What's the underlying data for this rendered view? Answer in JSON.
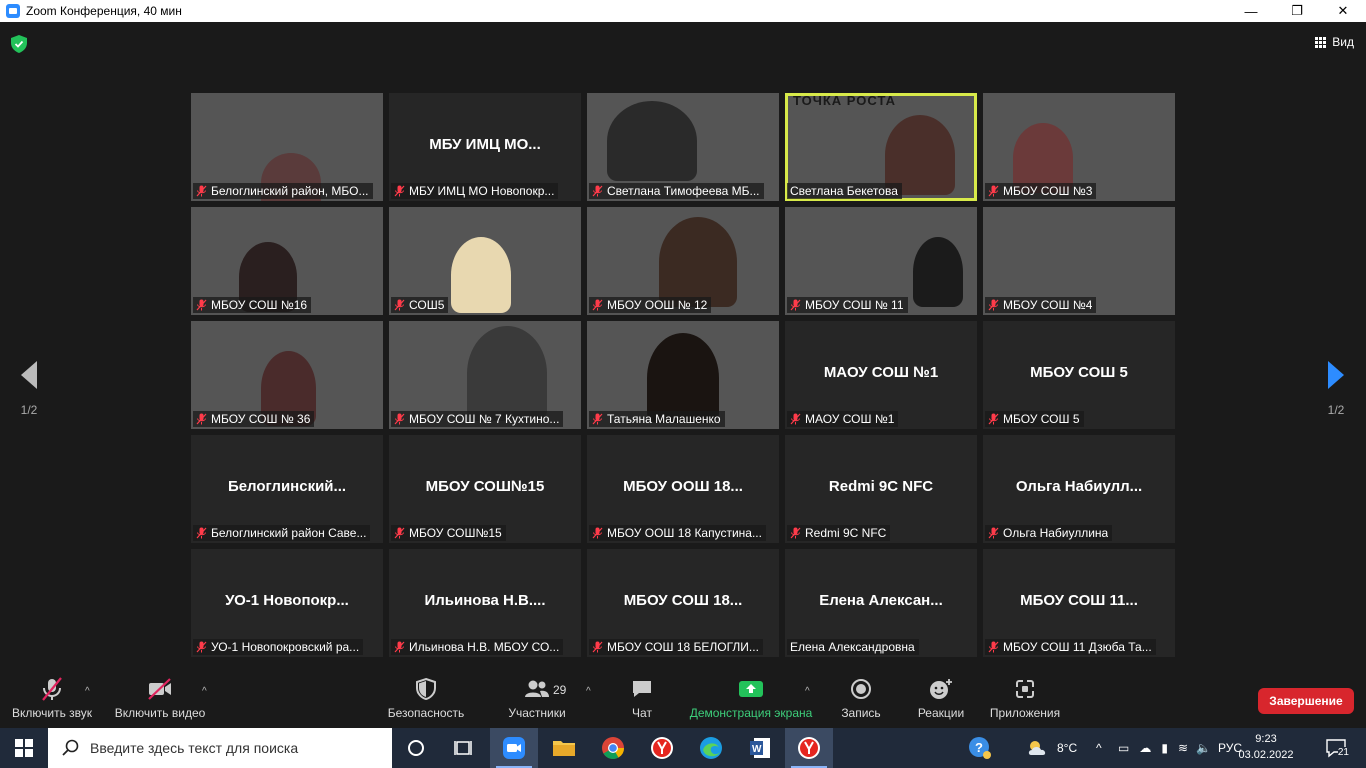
{
  "window": {
    "title": "Zoom Конференция, 40 мин",
    "controls": [
      "—",
      "❐",
      "✕"
    ]
  },
  "topbar": {
    "view_label": "Вид"
  },
  "pager": {
    "left": "1/2",
    "right": "1/2"
  },
  "tiles": [
    {
      "label": "Белоглинский район, МБО...",
      "center": "",
      "muted": true
    },
    {
      "label": "МБУ ИМЦ МО Новопокр...",
      "center": "МБУ ИМЦ МО...",
      "muted": true
    },
    {
      "label": "Светлана Тимофеева МБ...",
      "center": "",
      "muted": true
    },
    {
      "label": "Светлана Бекетова",
      "center": "",
      "muted": false,
      "banner": "ТОЧКА РОСТА"
    },
    {
      "label": "МБОУ СОШ №3",
      "center": "",
      "muted": true
    },
    {
      "label": "МБОУ СОШ №16",
      "center": "",
      "muted": true
    },
    {
      "label": "СОШ5",
      "center": "",
      "muted": true
    },
    {
      "label": "МБОУ ООШ № 12",
      "center": "",
      "muted": true
    },
    {
      "label": "МБОУ СОШ № 11",
      "center": "",
      "muted": true
    },
    {
      "label": "МБОУ СОШ №4",
      "center": "",
      "muted": true
    },
    {
      "label": "МБОУ СОШ № 36",
      "center": "",
      "muted": true
    },
    {
      "label": "МБОУ СОШ № 7 Кухтино...",
      "center": "",
      "muted": true
    },
    {
      "label": "Татьяна Малашенко",
      "center": "",
      "muted": true
    },
    {
      "label": "МАОУ СОШ №1",
      "center": "МАОУ СОШ №1",
      "muted": true
    },
    {
      "label": "МБОУ СОШ 5",
      "center": "МБОУ СОШ 5",
      "muted": true
    },
    {
      "label": "Белоглинский район Саве...",
      "center": "Белоглинский...",
      "muted": true
    },
    {
      "label": "МБОУ СОШ№15",
      "center": "МБОУ СОШ№15",
      "muted": true
    },
    {
      "label": "МБОУ ООШ 18 Капустина...",
      "center": "МБОУ ООШ 18...",
      "muted": true
    },
    {
      "label": "Redmi 9C NFC",
      "center": "Redmi 9C NFC",
      "muted": true
    },
    {
      "label": "Ольга Набиуллина",
      "center": "Ольга Набиулл...",
      "muted": true
    },
    {
      "label": "УО-1 Новопокровский ра...",
      "center": "УО-1 Новопокр...",
      "muted": true
    },
    {
      "label": "Ильинова Н.В. МБОУ СО...",
      "center": "Ильинова Н.В....",
      "muted": true
    },
    {
      "label": "МБОУ СОШ 18 БЕЛОГЛИ...",
      "center": "МБОУ СОШ 18...",
      "muted": true
    },
    {
      "label": "Елена Александровна",
      "center": "Елена Алексан...",
      "muted": false
    },
    {
      "label": "МБОУ СОШ 11 Дзюба Та...",
      "center": "МБОУ СОШ 11...",
      "muted": true
    }
  ],
  "toolbar": {
    "audio": "Включить звук",
    "video": "Включить видео",
    "security": "Безопасность",
    "participants": "Участники",
    "participants_count": "29",
    "chat": "Чат",
    "share": "Демонстрация экрана",
    "record": "Запись",
    "reactions": "Реакции",
    "apps": "Приложения",
    "end": "Завершение"
  },
  "taskbar": {
    "search_placeholder": "Введите здесь текст для поиска",
    "weather": "8°C",
    "lang": "РУС",
    "time": "9:23",
    "date": "03.02.2022",
    "notifications": "21"
  },
  "colors": {
    "active_speaker": "#d8ea4a",
    "share_green": "#3dce7a",
    "end_red": "#d8262d",
    "zoom_blue": "#2d8cff"
  }
}
